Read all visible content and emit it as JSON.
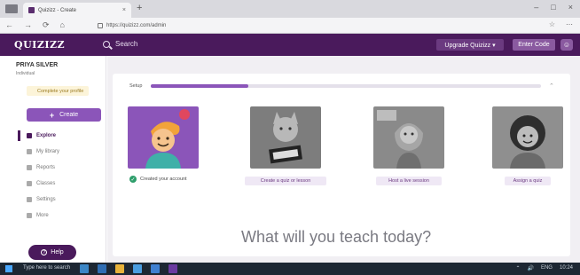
{
  "browser": {
    "tab_title": "Quizizz - Create",
    "tab_close": "×",
    "new_tab": "+",
    "window_controls": [
      "–",
      "□",
      "×"
    ],
    "nav": [
      "←",
      "→",
      "⟳",
      "⌂"
    ],
    "url": "https://quizizz.com/admin",
    "tools": [
      "☆",
      "⋯"
    ]
  },
  "appbar": {
    "logo": "QUIZIZZ",
    "search_label": "Search",
    "upgrade_label": "Upgrade Quizizz ▾",
    "enter_code_label": "Enter Code",
    "avatar_glyph": "☺"
  },
  "sidebar": {
    "org_name": "PRIYA SILVER",
    "org_sub": "Individual",
    "profile_label": "Complete your profile",
    "create_label": "Create",
    "items": [
      {
        "label": "Explore",
        "active": true
      },
      {
        "label": "My library",
        "active": false
      },
      {
        "label": "Reports",
        "active": false
      },
      {
        "label": "Classes",
        "active": false
      },
      {
        "label": "Settings",
        "active": false
      },
      {
        "label": "More",
        "active": false
      }
    ],
    "help_label": "Help"
  },
  "onboarding": {
    "progress_label": "Setup",
    "progress_fraction": 0.25,
    "collapse_glyph": "⌃",
    "completed_label": "Created your account",
    "tile_buttons": [
      "Create a quiz or lesson",
      "Host a live session",
      "Assign a quiz"
    ],
    "badge_glyph": "✓"
  },
  "main": {
    "headline": "What will you teach today?"
  },
  "taskbar": {
    "search_text": "Type here to search",
    "tray": [
      "⌃",
      "🔊",
      "ENG",
      "10:24"
    ]
  },
  "colors": {
    "brand": "#4a1a5c",
    "accent": "#8b55b9",
    "success": "#2e9e6b"
  }
}
